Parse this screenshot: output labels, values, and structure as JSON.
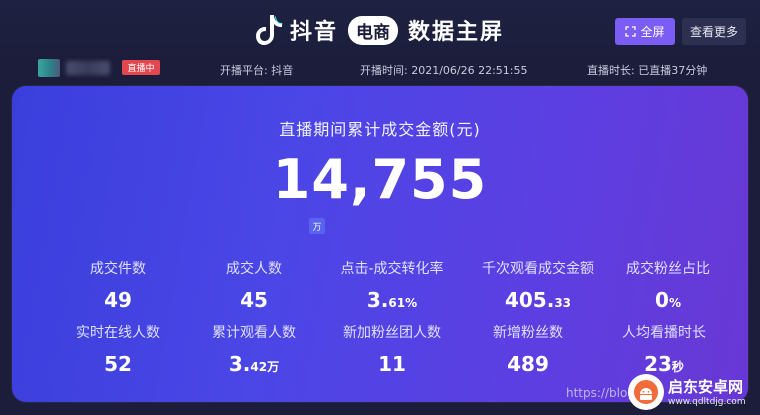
{
  "header": {
    "brand_name": "抖音",
    "brand_pill": "电商",
    "brand_sub": "数据主屏",
    "fullscreen_label": "全屏",
    "more_label": "查看更多"
  },
  "info": {
    "live_badge": "直播中",
    "platform": "开播平台: 抖音",
    "start_time": "开播时间: 2021/06/26 22:51:55",
    "duration": "直播时长: 已直播37分钟"
  },
  "main": {
    "title": "直播期间累计成交金额(元)",
    "value": "14,755",
    "unit": "万"
  },
  "metrics": [
    {
      "label": "成交件数",
      "value": "49",
      "suffix": ""
    },
    {
      "label": "成交人数",
      "value": "45",
      "suffix": ""
    },
    {
      "label": "点击-成交转化率",
      "value": "3.",
      "suffix": "61%"
    },
    {
      "label": "千次观看成交金额",
      "value": "405.",
      "suffix": "33"
    },
    {
      "label": "成交粉丝占比",
      "value": "0",
      "suffix": "%"
    },
    {
      "label": "实时在线人数",
      "value": "52",
      "suffix": ""
    },
    {
      "label": "累计观看人数",
      "value": "3.",
      "suffix": "42万"
    },
    {
      "label": "新加粉丝团人数",
      "value": "11",
      "suffix": ""
    },
    {
      "label": "新增粉丝数",
      "value": "489",
      "suffix": ""
    },
    {
      "label": "人均看播时长",
      "value": "23",
      "suffix": "秒"
    }
  ],
  "watermark": {
    "url": "https://blog.",
    "site_name": "启东安卓网",
    "site_url": "www.qdltdjg.com"
  },
  "colors": {
    "background": "#1b1d3a",
    "card_gradient_start": "#3a3fdc",
    "card_gradient_end": "#6838d4",
    "fullscreen_button": "#7b5cf5",
    "live_badge": "#e2474f"
  }
}
